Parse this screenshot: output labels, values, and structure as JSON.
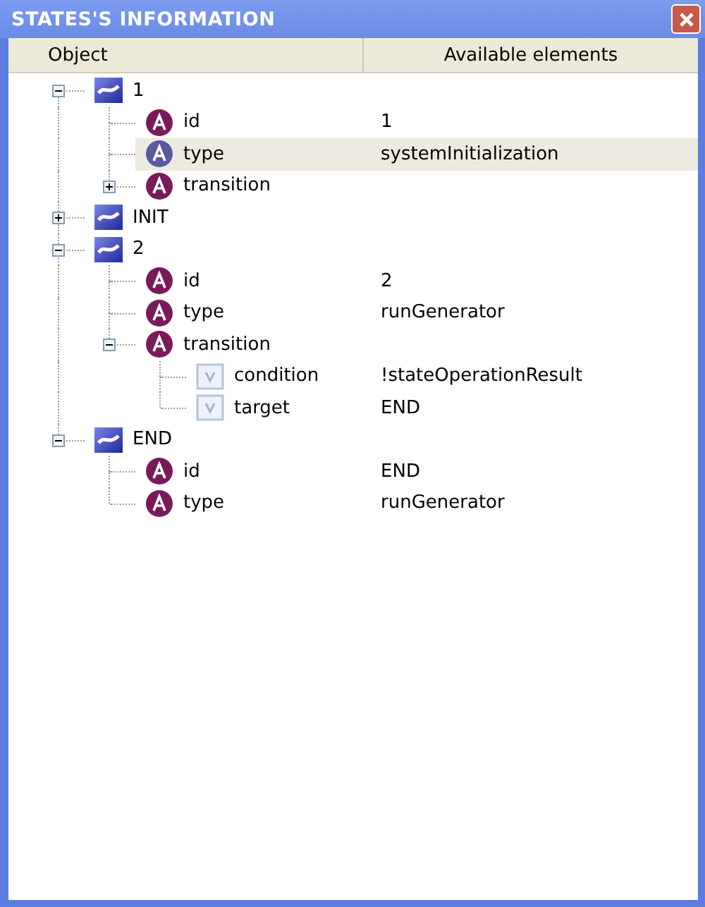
{
  "window": {
    "title": "STATES'S INFORMATION"
  },
  "columns": [
    "Object",
    "Available elements"
  ],
  "tree": [
    {
      "kind": "state",
      "label": "1",
      "expanded": true,
      "selected": false,
      "children": [
        {
          "kind": "attribute",
          "label": "id",
          "value": "1",
          "selected": false
        },
        {
          "kind": "attribute",
          "label": "type",
          "value": "systemInitialization",
          "selected": true
        },
        {
          "kind": "attribute",
          "label": "transition",
          "expanded": false,
          "selected": false
        }
      ]
    },
    {
      "kind": "state",
      "label": "INIT",
      "expanded": false,
      "selected": false
    },
    {
      "kind": "state",
      "label": "2",
      "expanded": true,
      "selected": false,
      "children": [
        {
          "kind": "attribute",
          "label": "id",
          "value": "2",
          "selected": false
        },
        {
          "kind": "attribute",
          "label": "type",
          "value": "runGenerator",
          "selected": false
        },
        {
          "kind": "attribute",
          "label": "transition",
          "expanded": true,
          "selected": false,
          "children": [
            {
              "kind": "value",
              "label": "condition",
              "value": "!stateOperationResult",
              "selected": false
            },
            {
              "kind": "value",
              "label": "target",
              "value": "END",
              "selected": false
            }
          ]
        }
      ]
    },
    {
      "kind": "state",
      "label": "END",
      "expanded": true,
      "selected": false,
      "children": [
        {
          "kind": "attribute",
          "label": "id",
          "value": "END",
          "selected": false
        },
        {
          "kind": "attribute",
          "label": "type",
          "value": "runGenerator",
          "selected": false
        }
      ]
    }
  ]
}
